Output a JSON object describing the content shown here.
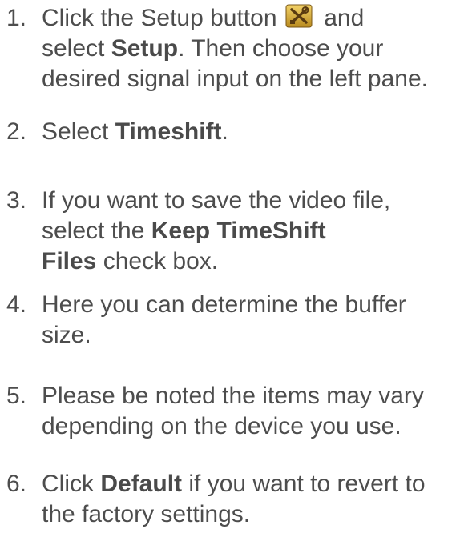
{
  "steps": [
    {
      "num": "1.",
      "l1_a": "Click the Setup button",
      "l1_b": "and",
      "l2_a": "select ",
      "l2_b": "Setup",
      "l2_c": ". Then choose your",
      "l3": "desired signal input on the left pane."
    },
    {
      "num": "2.",
      "a": "Select ",
      "b": "Timeshift",
      "c": "."
    },
    {
      "num": "3.",
      "l1": "If you want to save the video file,",
      "l2_a": "select the ",
      "l2_b": "Keep TimeShift",
      "l3_a": "Files",
      "l3_b": " check box."
    },
    {
      "num": "4.",
      "l1": "Here you can determine the buffer",
      "l2": "size."
    },
    {
      "num": "5.",
      "l1": "Please be noted the items may vary",
      "l2": "depending on the device you use."
    },
    {
      "num": "6.",
      "l1_a": "Click ",
      "l1_b": "Default",
      "l1_c": " if you want to revert to",
      "l2": "the factory settings."
    }
  ],
  "icons": {
    "setup": "setup-tools-icon"
  },
  "colors": {
    "text": "#4d4d4d",
    "icon_bg": "#d9b23a",
    "icon_dark": "#5a3b10"
  }
}
